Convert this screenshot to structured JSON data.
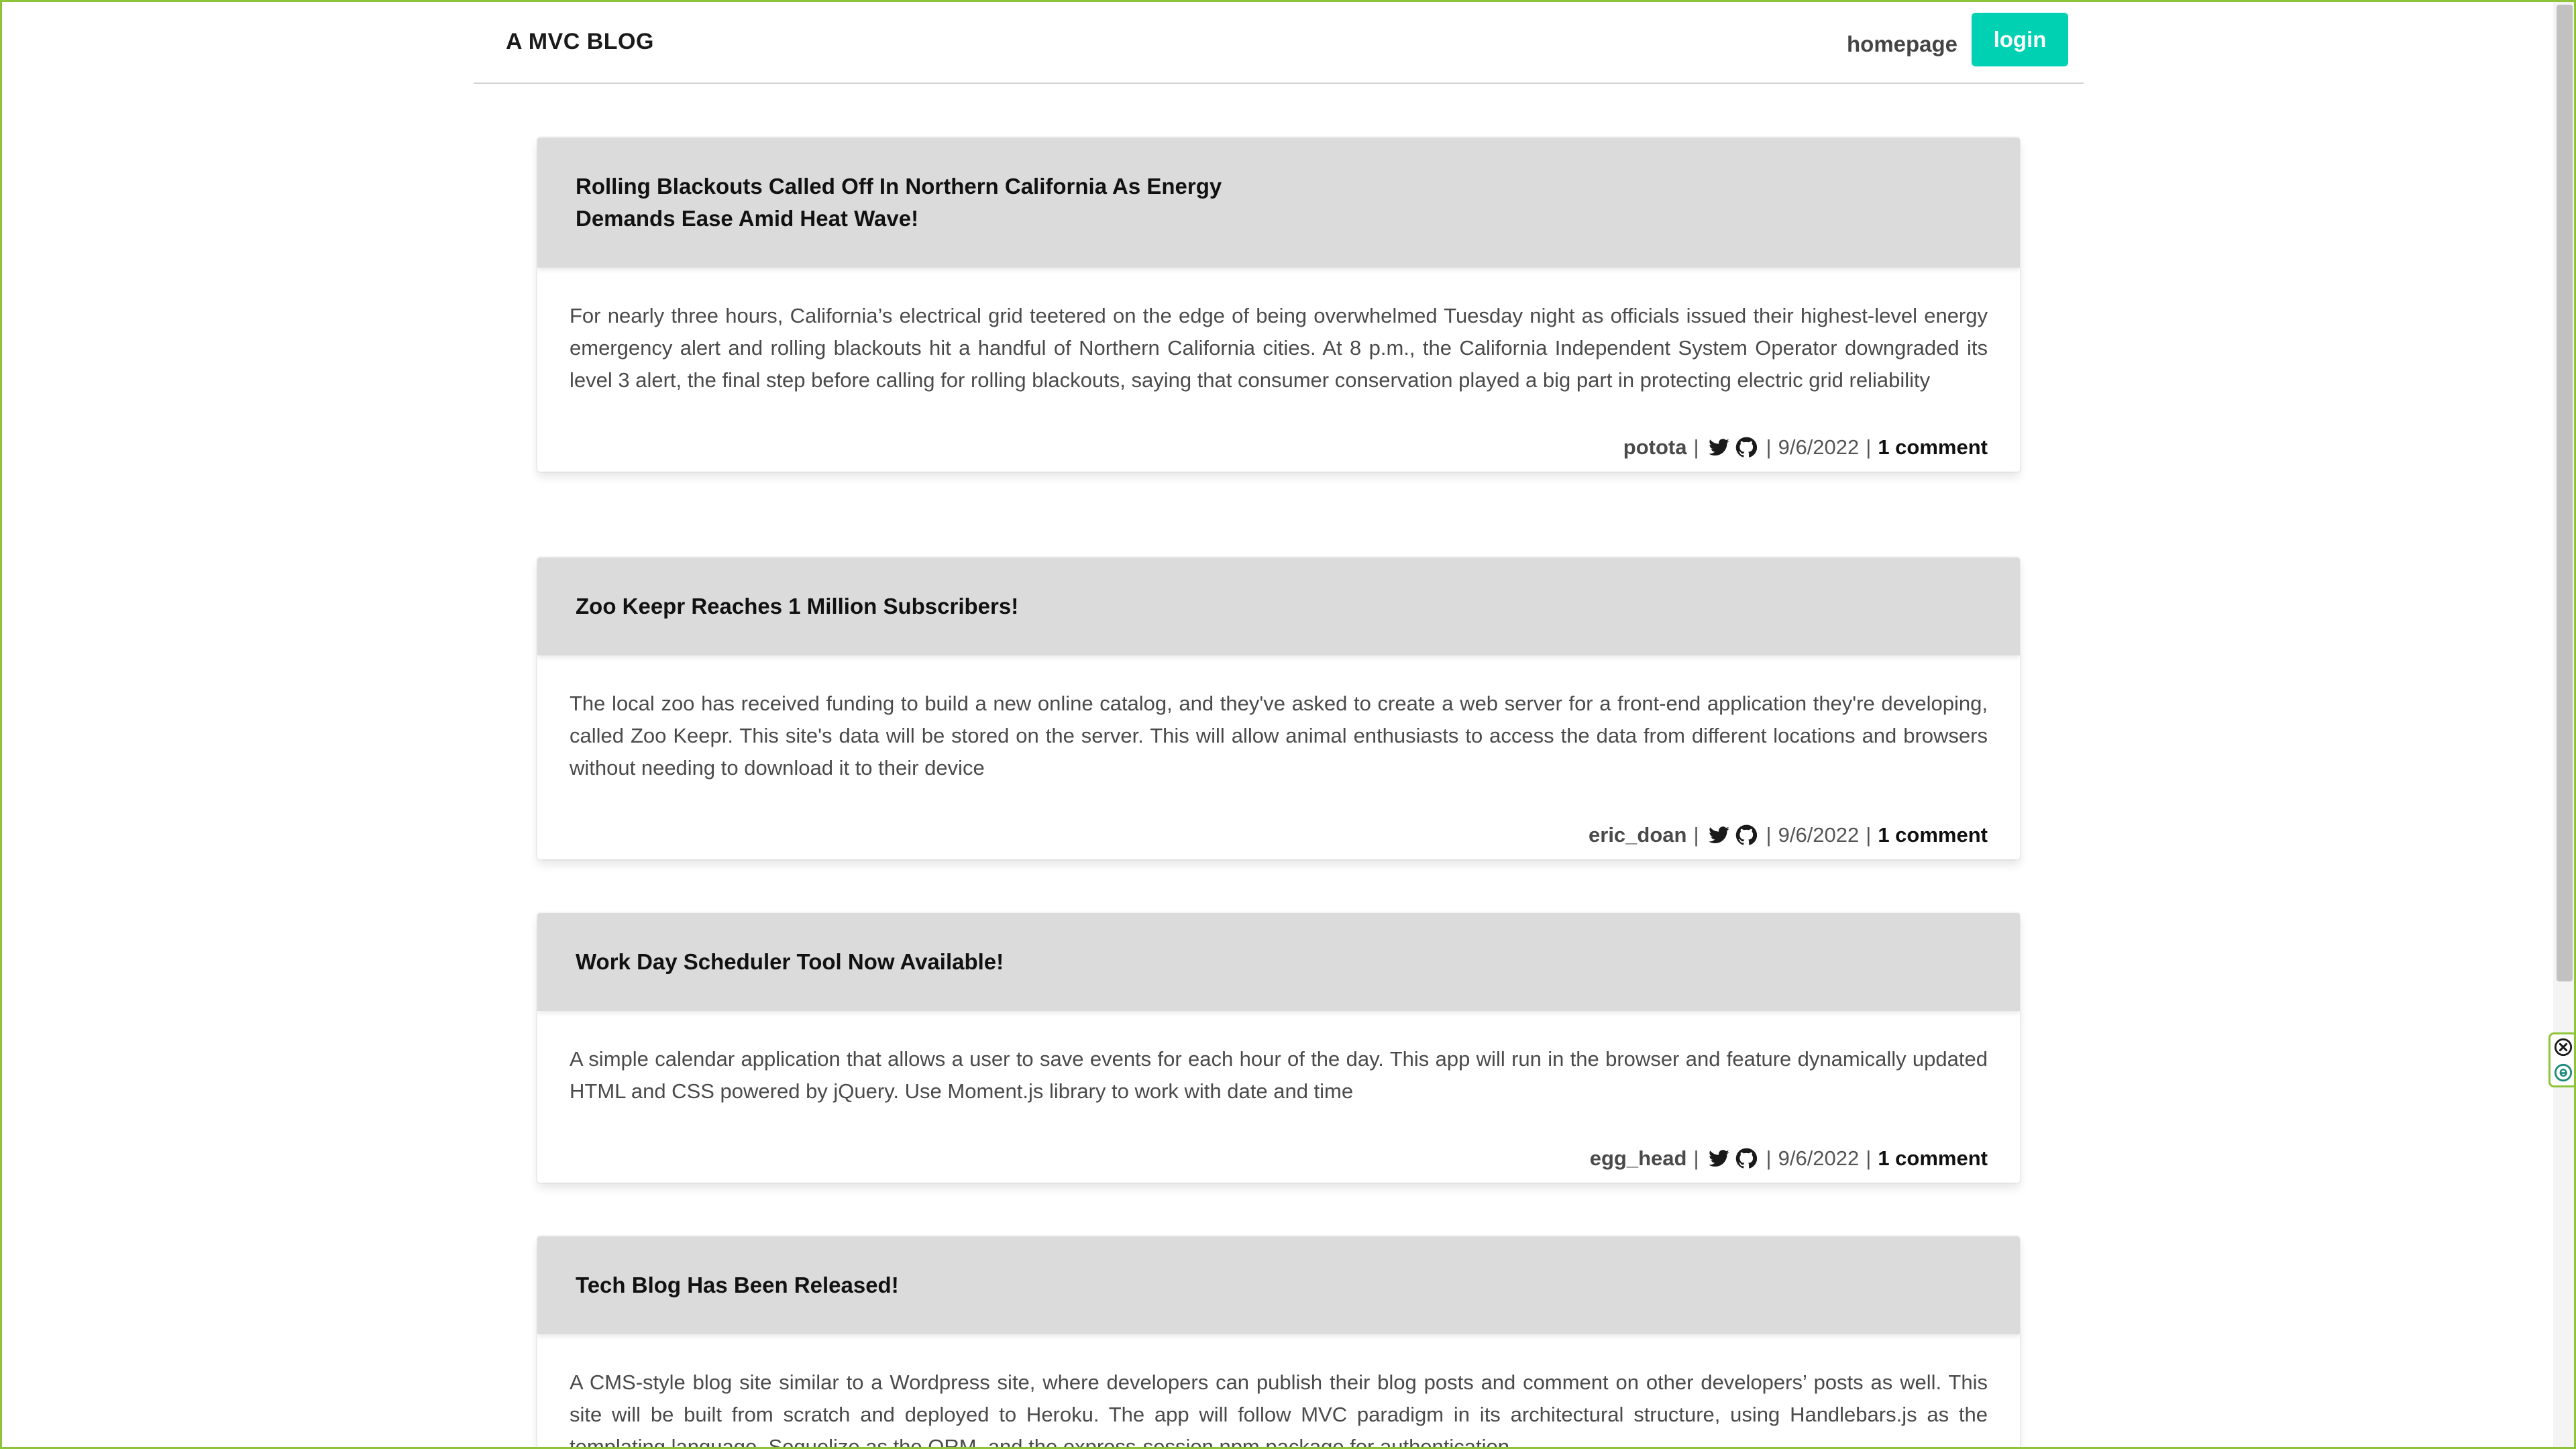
{
  "navbar": {
    "brand": "A MVC BLOG",
    "homepage_label": "homepage",
    "login_label": "login",
    "login_color": "#00d1b2"
  },
  "posts": [
    {
      "title": "Rolling Blackouts Called Off In Northern California As Energy Demands Ease Amid Heat Wave!",
      "body": "For nearly three hours, California’s electrical grid teetered on the edge of being overwhelmed Tuesday night as officials issued their highest-level energy emergency alert and rolling blackouts hit a handful of Northern California cities. At 8 p.m., the California Independent System Operator downgraded its level 3 alert, the final step before calling for rolling blackouts, saying that consumer conservation played a big part in protecting electric grid reliability",
      "author": "potota",
      "date": "9/6/2022",
      "comments": "1 comment"
    },
    {
      "title": "Zoo Keepr Reaches 1 Million Subscribers!",
      "body": "The local zoo has received funding to build a new online catalog, and they've asked to create a web server for a front-end application they're developing, called Zoo Keepr. This site's data will be stored on the server. This will allow animal enthusiasts to access the data from different locations and browsers without needing to download it to their device",
      "author": "eric_doan",
      "date": "9/6/2022",
      "comments": "1 comment"
    },
    {
      "title": "Work Day Scheduler Tool Now Available!",
      "body": "A simple calendar application that allows a user to save events for each hour of the day. This app will run in the browser and feature dynamically updated HTML and CSS powered by jQuery. Use Moment.js library to work with date and time",
      "author": "egg_head",
      "date": "9/6/2022",
      "comments": "1 comment"
    },
    {
      "title": "Tech Blog Has Been Released!",
      "body": "A CMS-style blog site similar to a Wordpress site, where developers can publish their blog posts and comment on other developers’ posts as well. This site will be built from scratch and deployed to Heroku. The app will follow MVC paradigm in its architectural structure, using Handlebars.js as the templating language, Sequelize as the ORM, and the express-session npm package for authentication",
      "author": "",
      "date": "",
      "comments": ""
    }
  ],
  "meta_separator": "|",
  "icons": {
    "twitter": "twitter-icon",
    "github": "github-icon",
    "widget_close": "close-circle-icon",
    "widget_extra": "e-circle-icon"
  },
  "colors": {
    "page_border": "#8fc43a",
    "post_header_bg": "#dbdbdb"
  }
}
